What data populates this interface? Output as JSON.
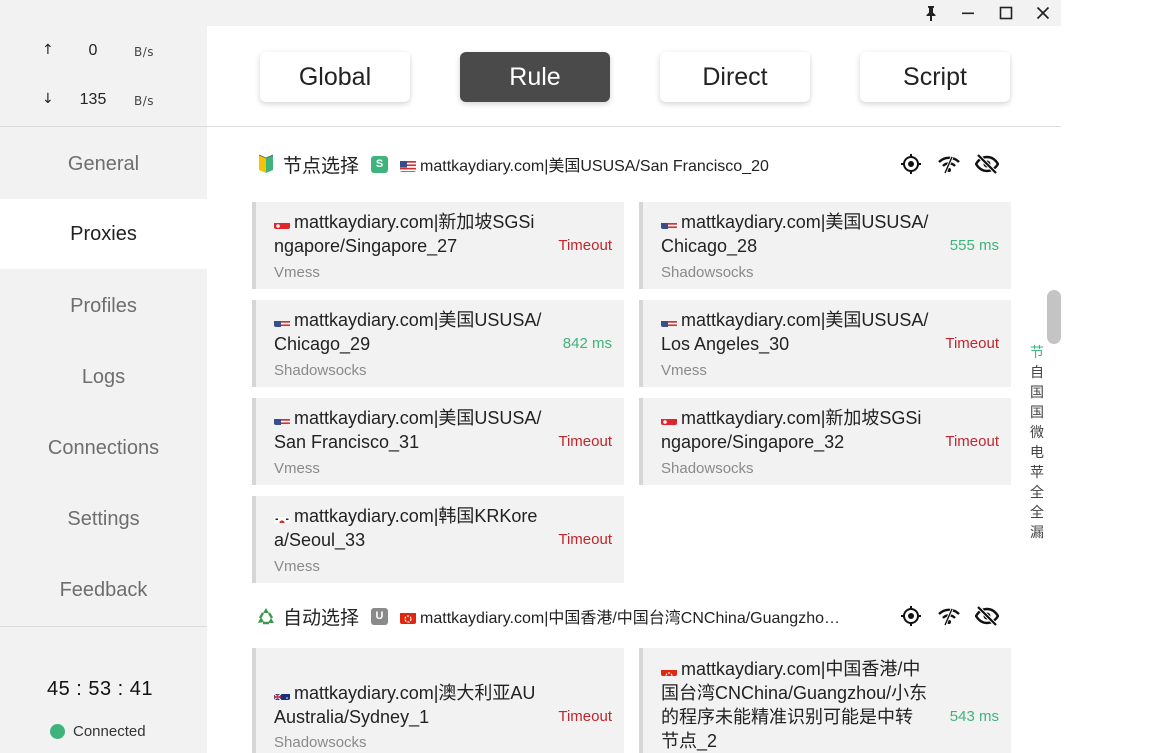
{
  "window": {
    "pin_icon": "pin-icon",
    "minimize_icon": "minimize-icon",
    "maximize_icon": "maximize-icon",
    "close_icon": "close-icon"
  },
  "traffic": {
    "up_arrow": "↑",
    "up_value": "0",
    "up_unit": "B/s",
    "down_arrow": "↓",
    "down_value": "135",
    "down_unit": "B/s"
  },
  "nav": {
    "general": "General",
    "proxies": "Proxies",
    "profiles": "Profiles",
    "logs": "Logs",
    "connections": "Connections",
    "settings": "Settings",
    "feedback": "Feedback"
  },
  "footer": {
    "clock": "45 : 53 : 41",
    "status": "Connected",
    "status_color": "#3fb37c"
  },
  "modes": {
    "global": "Global",
    "rule": "Rule",
    "direct": "Direct",
    "script": "Script",
    "active": "Rule"
  },
  "groups": [
    {
      "name": "节点选择",
      "emoji": "🔰",
      "tag": "S",
      "tag_color": "#3fb37c",
      "now": "mattkaydiary.com|美国USUSA/San Francisco_20",
      "now_flag": "us",
      "proxies": [
        {
          "name": "mattkaydiary.com|新加坡SGSingapore/Singapore_27",
          "type": "Vmess",
          "delay": "Timeout",
          "flag": "sg"
        },
        {
          "name": "mattkaydiary.com|美国USUSA/Chicago_28",
          "type": "Shadowsocks",
          "delay": "555 ms",
          "flag": "us"
        },
        {
          "name": "mattkaydiary.com|美国USUSA/Chicago_29",
          "type": "Shadowsocks",
          "delay": "842 ms",
          "flag": "us"
        },
        {
          "name": "mattkaydiary.com|美国USUSA/Los Angeles_30",
          "type": "Vmess",
          "delay": "Timeout",
          "flag": "us"
        },
        {
          "name": "mattkaydiary.com|美国USUSA/San Francisco_31",
          "type": "Vmess",
          "delay": "Timeout",
          "flag": "us"
        },
        {
          "name": "mattkaydiary.com|新加坡SGSingapore/Singapore_32",
          "type": "Shadowsocks",
          "delay": "Timeout",
          "flag": "sg"
        },
        {
          "name": "mattkaydiary.com|韩国KRKorea/Seoul_33",
          "type": "Vmess",
          "delay": "Timeout",
          "flag": "kr"
        }
      ]
    },
    {
      "name": "自动选择",
      "emoji": "♻️",
      "tag": "U",
      "tag_color": "#8a8a8a",
      "now": "mattkaydiary.com|中国香港/中国台湾CNChina/Guangzho…",
      "now_flag": "hk",
      "proxies": [
        {
          "name": "mattkaydiary.com|澳大利亚AUAustralia/Sydney_1",
          "type": "Shadowsocks",
          "delay": "Timeout",
          "flag": "au"
        },
        {
          "name": "mattkaydiary.com|中国香港/中国台湾CNChina/Guangzhou/小东的程序未能精准识别可能是中转节点_2",
          "type": "",
          "delay": "543 ms",
          "flag": "hk"
        }
      ]
    }
  ],
  "group_actions": [
    "locate-icon",
    "speed-test-icon",
    "hide-icon"
  ],
  "index": [
    "节",
    "自",
    "国",
    "国",
    "微",
    "电",
    "苹",
    "全",
    "全",
    "漏"
  ],
  "colors": {
    "accent_green": "#3fb37c",
    "timeout_red": "#c0262d",
    "active_mode": "#4a4a4a"
  }
}
